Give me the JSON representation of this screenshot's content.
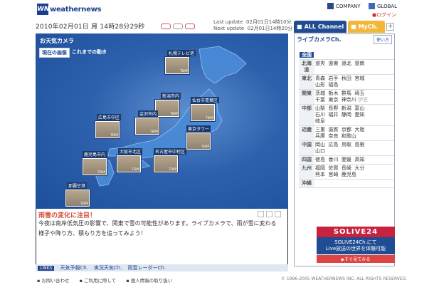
{
  "header": {
    "logo_mark": "WN",
    "logo_text": "weathernews",
    "company": "COMPANY",
    "global": "GLOBAL",
    "login": "ログイン"
  },
  "datebar": {
    "date": "2010年02月01日",
    "weekday": "月",
    "time": "14時28分29秒",
    "last_update_label": "Last update",
    "last_update": "02月01日14時10分",
    "next_update_label": "Next update",
    "next_update": "02月01日14時20分"
  },
  "tabs": {
    "all": "ALL Channel",
    "my": "MyCh."
  },
  "main": {
    "title": "お天気カメラ",
    "now_btn": "現在の画像",
    "past_btn": "これまでの動き",
    "cams": [
      {
        "city": "札幌テレビ塔"
      },
      {
        "city": "新潟市内"
      },
      {
        "city": "仙台市青葉区"
      },
      {
        "city": "広島市中区"
      },
      {
        "city": "金沢市内"
      },
      {
        "city": "東京タワー"
      },
      {
        "city": "大阪市北区"
      },
      {
        "city": "名古屋市中村区"
      },
      {
        "city": "鹿児島市内"
      },
      {
        "city": "那覇空港"
      }
    ],
    "temp_label": "TEMP",
    "article_title": "雨雪の変化に注目！",
    "article_body": "今夜は南岸低気圧の影響で、関東で雪の可能性があります。ライブカメラで、雨が雪に変わる様子や降り方、積もり方を追ってみよう！",
    "links": [
      "天気予報Ch.",
      "実況天気Ch.",
      "雨雲レーダーCh."
    ],
    "link_badge": "LINKS"
  },
  "side": {
    "title": "ライブカメラCh.",
    "help": "使い方",
    "all": "全国",
    "regions": [
      {
        "r": "北海道",
        "cities": [
          "道央",
          "道東",
          "道北",
          "道南"
        ]
      },
      {
        "r": "東北",
        "cities": [
          "青森",
          "岩手",
          "秋田",
          "宮城",
          "山形",
          "福島"
        ]
      },
      {
        "r": "関東",
        "cities": [
          "茨城",
          "栃木",
          "群馬",
          "埼玉",
          "千葉",
          "東京",
          "神奈川",
          "伊豆"
        ]
      },
      {
        "r": "中部",
        "cities": [
          "山梨",
          "長野",
          "新潟",
          "富山",
          "石川",
          "福井",
          "静岡",
          "愛知",
          "岐阜"
        ]
      },
      {
        "r": "近畿",
        "cities": [
          "三重",
          "滋賀",
          "京都",
          "大阪",
          "兵庫",
          "奈良",
          "和歌山"
        ]
      },
      {
        "r": "中国",
        "cities": [
          "岡山",
          "広島",
          "鳥取",
          "島根",
          "山口"
        ]
      },
      {
        "r": "四国",
        "cities": [
          "徳島",
          "香川",
          "愛媛",
          "高知"
        ]
      },
      {
        "r": "九州",
        "cities": [
          "福岡",
          "佐賀",
          "長崎",
          "大分",
          "熊本",
          "宮崎",
          "鹿児島"
        ]
      },
      {
        "r": "沖縄",
        "cities": []
      }
    ],
    "ad_logo": "SOLIVE24",
    "ad_line1": "SOLIVE24Ch.にて",
    "ad_line2": "Live放送の世界を体験可能",
    "ad_go": "▶すぐ見てみる"
  },
  "footer": {
    "links": [
      "お問い合わせ",
      "ご利用に際して",
      "個人情報の取り扱い"
    ],
    "copyright": "© 1996-2005 WEATHERNEWS INC. ALL RIGHTS RESERVED."
  }
}
